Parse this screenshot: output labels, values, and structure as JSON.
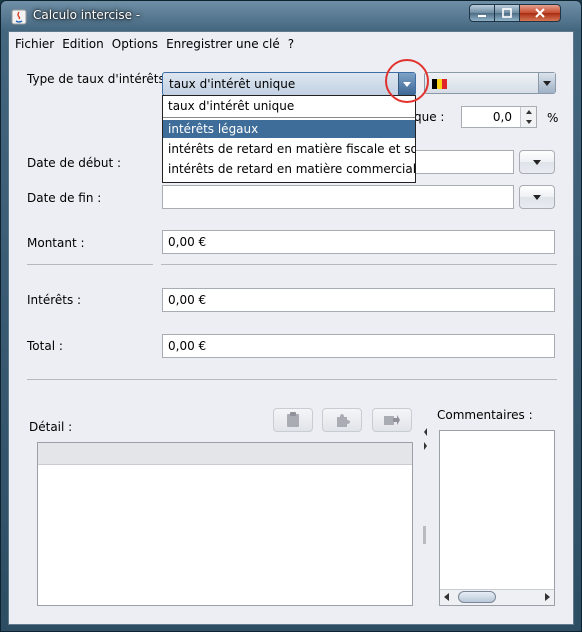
{
  "window": {
    "title": "Calculo intercise -",
    "controls": [
      "minimize",
      "maximize",
      "close"
    ]
  },
  "menubar": {
    "items": [
      "Fichier",
      "Edition",
      "Options",
      "Enregistrer une clé",
      "?"
    ]
  },
  "form": {
    "rate_type_label": "Type de taux d'intérêts :",
    "rate_type_selected": "taux d'intérêt unique",
    "rate_options": [
      "taux d'intérêt unique",
      "intérêts légaux",
      "intérêts de retard en matière fiscale et sociale",
      "intérêts de retard en matière commerciale"
    ],
    "rate_options_highlighted": "intérêts légaux",
    "country_flag": {
      "name": "belgium-flag",
      "colors": [
        "#000000",
        "#f9d41a",
        "#e0242b"
      ]
    },
    "unique_rate_label_fragment": "que :",
    "rate_value": "0,0",
    "percent_sign": "%",
    "start_date_label": "Date de début :",
    "start_date_value": "",
    "end_date_label": "Date de fin :",
    "end_date_value": "",
    "amount_label": "Montant :",
    "amount_value": "0,00 €",
    "interest_label": "Intérêts :",
    "interest_value": "0,00 €",
    "total_label": "Total :",
    "total_value": "0,00 €"
  },
  "detail": {
    "label": "Détail :",
    "toolbar_icons": [
      "clipboard-icon",
      "puzzle-icon",
      "export-icon"
    ]
  },
  "comments": {
    "label": "Commentaires :"
  },
  "annotation": {
    "color": "#e1322e"
  }
}
